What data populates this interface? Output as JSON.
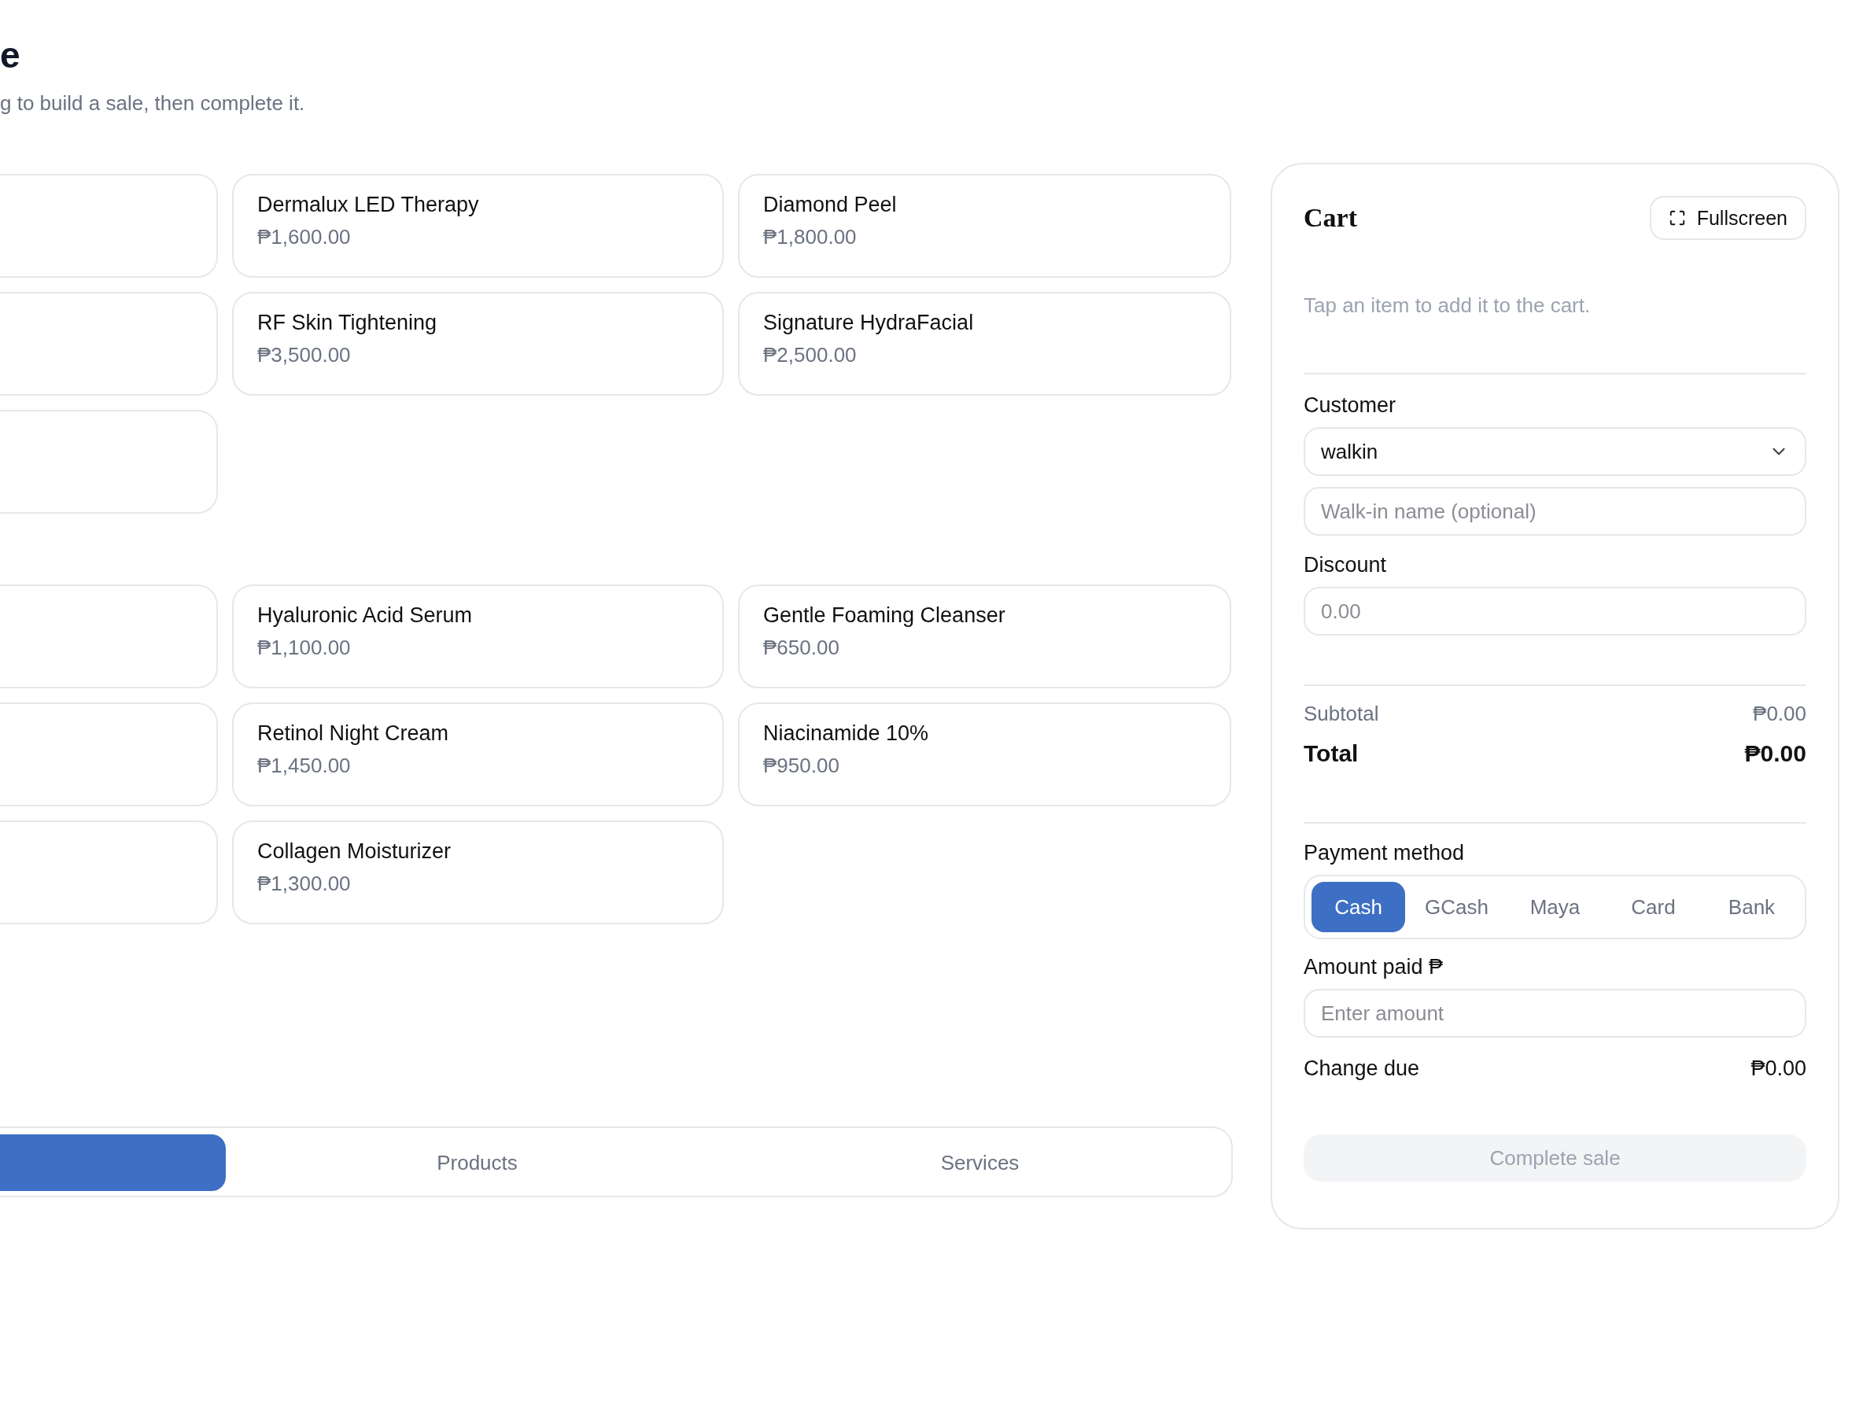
{
  "header": {
    "title": "e",
    "subtitle": "g to build a sale, then complete it."
  },
  "sections": [
    {
      "items": [
        {
          "kind": "cut"
        },
        {
          "kind": "full",
          "name": "Dermalux LED Therapy",
          "price": "₱1,600.00"
        },
        {
          "kind": "full",
          "name": "Diamond Peel",
          "price": "₱1,800.00"
        },
        {
          "kind": "cut"
        },
        {
          "kind": "full",
          "name": "RF Skin Tightening",
          "price": "₱3,500.00"
        },
        {
          "kind": "full",
          "name": "Signature HydraFacial",
          "price": "₱2,500.00"
        },
        {
          "kind": "cut"
        }
      ]
    },
    {
      "items": [
        {
          "kind": "cut"
        },
        {
          "kind": "full",
          "name": "Hyaluronic Acid Serum",
          "price": "₱1,100.00"
        },
        {
          "kind": "full",
          "name": "Gentle Foaming Cleanser",
          "price": "₱650.00"
        },
        {
          "kind": "cut"
        },
        {
          "kind": "full",
          "name": "Retinol Night Cream",
          "price": "₱1,450.00"
        },
        {
          "kind": "full",
          "name": "Niacinamide 10%",
          "price": "₱950.00"
        },
        {
          "kind": "cut"
        },
        {
          "kind": "full",
          "name": "Collagen Moisturizer",
          "price": "₱1,300.00"
        }
      ]
    }
  ],
  "tabs": [
    {
      "selected": true
    },
    {
      "label": "Products",
      "selected": false
    },
    {
      "label": "Services",
      "selected": false
    }
  ],
  "cart": {
    "title": "Cart",
    "fullscreen_button": "Fullscreen",
    "empty_message": "Tap an item to add it to the cart.",
    "customer": {
      "label": "Customer",
      "value": "walkin",
      "name_placeholder": "Walk-in name (optional)"
    },
    "discount": {
      "label": "Discount",
      "placeholder": "0.00"
    },
    "subtotal": {
      "label": "Subtotal",
      "value": "₱0.00"
    },
    "total": {
      "label": "Total",
      "value": "₱0.00"
    },
    "payment": {
      "label": "Payment method",
      "methods": [
        {
          "label": "Cash",
          "selected": true
        },
        {
          "label": "GCash",
          "selected": false
        },
        {
          "label": "Maya",
          "selected": false
        },
        {
          "label": "Card",
          "selected": false
        },
        {
          "label": "Bank",
          "selected": false
        }
      ]
    },
    "amount_paid": {
      "label": "Amount paid ₱",
      "placeholder": "Enter amount"
    },
    "change_due": {
      "label": "Change due",
      "value": "₱0.00"
    },
    "complete_button": {
      "label": "Complete sale",
      "disabled": true
    }
  }
}
